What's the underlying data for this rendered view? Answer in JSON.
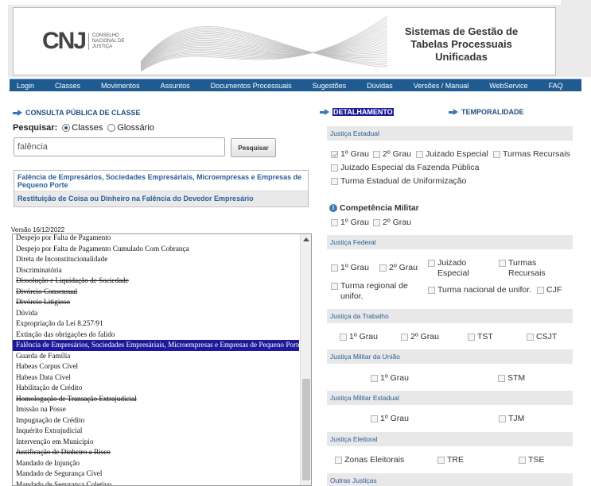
{
  "header": {
    "logo_mark": "CNJ",
    "logo_sub": "Conselho Nacional de Justiça",
    "system_title": "Sistemas de Gestão de Tabelas Processuais Unificadas"
  },
  "nav": [
    "Login",
    "Classes",
    "Movimentos",
    "Assuntos",
    "Documentos Processuais",
    "Sugestões",
    "Dúvidas",
    "Versões / Manual",
    "WebService",
    "FAQ"
  ],
  "consulta": {
    "title": "CONSULTA PÚBLICA DE CLASSE",
    "search_label": "Pesquisar:",
    "radio_classes": "Classes",
    "radio_glossario": "Glossário",
    "search_value": "falência",
    "search_button": "Pesquisar",
    "results": [
      "Falência de Empresários, Sociedades Empresáriais, Microempresas e Empresas de Pequeno Porte",
      "Restituição de Coisa ou Dinheiro na Falência do Devedor Empresário"
    ],
    "version": "Versão 16/12/2022"
  },
  "list": [
    {
      "t": "Despejo por Falta de Pagamento",
      "s": false
    },
    {
      "t": "Despejo por Falta de Pagamento Cumulado Com Cobrança",
      "s": false
    },
    {
      "t": "Direta de Inconstitucionalidade",
      "s": false
    },
    {
      "t": "Discriminatória",
      "s": false
    },
    {
      "t": "Dissolução e Liquidação de Sociedade",
      "s": true
    },
    {
      "t": "Divórcio Consensual",
      "s": true
    },
    {
      "t": "Divórcio Litigioso",
      "s": true
    },
    {
      "t": "Dúvida",
      "s": false
    },
    {
      "t": "Expropriação da Lei 8.257/91",
      "s": false
    },
    {
      "t": "Extinção das obrigações do falido",
      "s": false
    },
    {
      "t": "Falência de Empresários, Sociedades Empresáriais, Microempresas e Empresas de Pequeno Porte",
      "s": false,
      "sel": true
    },
    {
      "t": "Guarda de Família",
      "s": false
    },
    {
      "t": "Habeas Corpus Cível",
      "s": false
    },
    {
      "t": "Habeas Data Cível",
      "s": false
    },
    {
      "t": "Habilitação de Crédito",
      "s": false
    },
    {
      "t": "Homologação de Transação Extrajudicial",
      "s": true
    },
    {
      "t": "Imissão na Posse",
      "s": false
    },
    {
      "t": "Impugnação de Crédito",
      "s": false
    },
    {
      "t": "Inquérito Extrajudicial",
      "s": false
    },
    {
      "t": "Intervenção em Município",
      "s": false
    },
    {
      "t": "Justificação de Dinheiro a Risco",
      "s": true
    },
    {
      "t": "Mandado de Injunção",
      "s": false
    },
    {
      "t": "Mandado de Segurança Cível",
      "s": false
    },
    {
      "t": "Mandado de Segurança Coletivo",
      "s": false
    }
  ],
  "tabs": {
    "detalhamento": "DETALHAMENTO",
    "temporalidade": "TEMPORALIDADE"
  },
  "detail": {
    "justica_estadual": "Justiça Estadual",
    "je_1grau": "1º Grau",
    "je_2grau": "2º Grau",
    "je_juizado": "Juizado Especial",
    "je_turmas": "Turmas Recursais",
    "je_fazenda": "Juizado Especial da Fazenda Pública",
    "je_uniform": "Turma Estadual de Uniformização",
    "competencia_militar": "Competência Militar",
    "cm_1grau": "1º Grau",
    "cm_2grau": "2º Grau",
    "justica_federal": "Justiça Federal",
    "jf_1grau": "1º Grau",
    "jf_2grau": "2º Grau",
    "jf_juizado": "Juizado Especial",
    "jf_turmas": "Turmas Recursais",
    "jf_regional": "Turma regional de unifor.",
    "jf_nacional": "Turma nacional de unifor.",
    "jf_cjf": "CJF",
    "justica_trabalho": "Justiça da Trabalho",
    "jt_1grau": "1º Grau",
    "jt_2grau": "2º Grau",
    "jt_tst": "TST",
    "jt_csjt": "CSJT",
    "justica_militar_uniao": "Justiça Militar da União",
    "jmu_1grau": "1º Grau",
    "jmu_stm": "STM",
    "justica_militar_estadual": "Justiça Militar Estadual",
    "jme_1grau": "1º Grau",
    "jme_tjm": "TJM",
    "justica_eleitoral": "Justiça Eleitoral",
    "jel_zonas": "Zonas Eleitorais",
    "jel_tre": "TRE",
    "jel_tse": "TSE",
    "outras_justicas": "Outras Justiças"
  }
}
